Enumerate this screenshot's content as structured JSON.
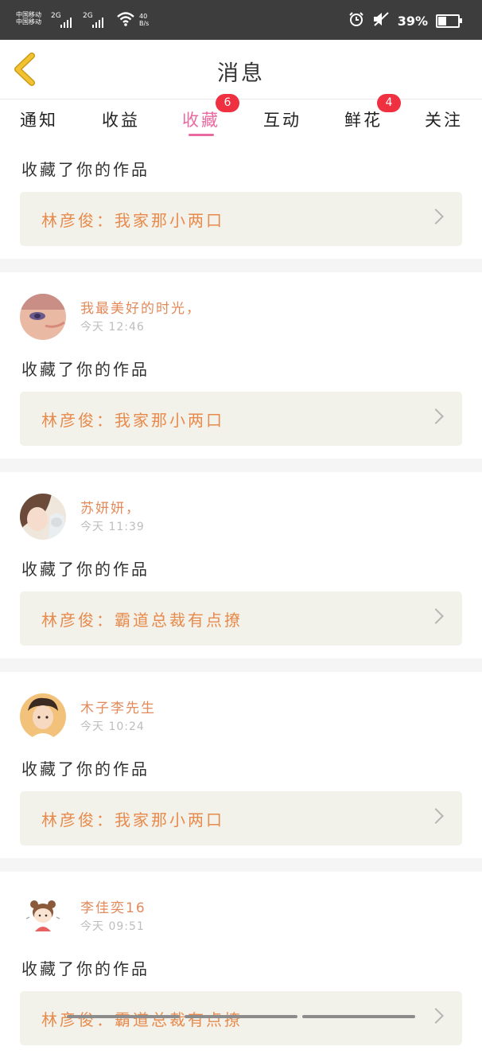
{
  "status_bar": {
    "carrier_1": "中国移动",
    "carrier_2": "中国移动",
    "network_1": "2G",
    "network_2": "2G",
    "net_speed_value": "40",
    "net_speed_unit": "B/s",
    "battery_percent": "39%",
    "battery_level": 0.39,
    "icons": [
      "signal-icon",
      "wifi-icon",
      "alarm-icon",
      "mute-icon",
      "battery-icon"
    ]
  },
  "header": {
    "title": "消息",
    "back_icon": "chevron-left-icon",
    "accent": "#f2c230"
  },
  "tabs": [
    {
      "label": "通知",
      "badge": ""
    },
    {
      "label": "收益",
      "badge": ""
    },
    {
      "label": "收藏",
      "badge": "6",
      "active": true
    },
    {
      "label": "互动",
      "badge": ""
    },
    {
      "label": "鲜花",
      "badge": "4"
    },
    {
      "label": "关注",
      "badge": ""
    }
  ],
  "colors": {
    "active_tab": "#e86aa0",
    "badge": "#ef3040",
    "username": "#e28a5a",
    "work_title": "#e88a4c",
    "link_bg": "#f2f2ea"
  },
  "notifications": [
    {
      "user": "",
      "time": "",
      "action": "收藏了你的作品",
      "work": "林彦俊：我家那小两口"
    },
    {
      "user": "我最美好的时光，",
      "time": "今天 12:46",
      "action": "收藏了你的作品",
      "work": "林彦俊：我家那小两口"
    },
    {
      "user": "苏妍妍，",
      "time": "今天 11:39",
      "action": "收藏了你的作品",
      "work": "林彦俊：霸道总裁有点撩"
    },
    {
      "user": "木子李先生",
      "time": "今天 10:24",
      "action": "收藏了你的作品",
      "work": "林彦俊：我家那小两口"
    },
    {
      "user": "李佳奕16",
      "time": "今天 09:51",
      "action": "收藏了你的作品",
      "work": "林彦俊：霸道总裁有点撩"
    }
  ]
}
